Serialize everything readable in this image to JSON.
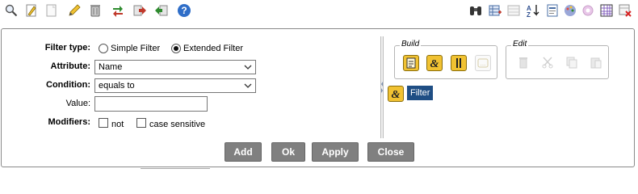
{
  "toolbar": {
    "left_icons": [
      "search-icon",
      "edit-document-icon",
      "blank-document-icon",
      "pencil-icon",
      "trash-can-icon",
      "swap-arrows-icon",
      "export-red-icon",
      "import-green-icon",
      "help-icon"
    ],
    "right_icons": [
      "binoculars-icon",
      "add-column-icon",
      "table-icon",
      "sort-az-icon",
      "report-icon",
      "palette-icon",
      "gear-icon",
      "grid-icon",
      "delete-table-icon"
    ]
  },
  "form": {
    "filter_type_label": "Filter type:",
    "simple_filter_label": "Simple Filter",
    "extended_filter_label": "Extended Filter",
    "selected_filter_type": "extended",
    "attribute_label": "Attribute:",
    "attribute_value": "Name",
    "condition_label": "Condition:",
    "condition_value": "equals to",
    "value_label": "Value:",
    "value_text": "",
    "modifiers_label": "Modifiers:",
    "not_label": "not",
    "case_sensitive_label": "case sensitive",
    "not_checked": false,
    "case_sensitive_checked": false
  },
  "build": {
    "title": "Build",
    "buttons": [
      "condition-icon",
      "and-icon",
      "or-icon",
      "group-icon"
    ]
  },
  "edit": {
    "title": "Edit",
    "buttons": [
      "delete-icon",
      "cut-icon",
      "copy-icon",
      "paste-icon"
    ]
  },
  "tree": {
    "node_label": "Filter"
  },
  "actions": {
    "add": "Add",
    "ok": "Ok",
    "apply": "Apply",
    "close": "Close"
  },
  "colors": {
    "accent_yellow": "#f1c232",
    "selection_blue": "#1f4e84",
    "button_gray": "#808080"
  }
}
